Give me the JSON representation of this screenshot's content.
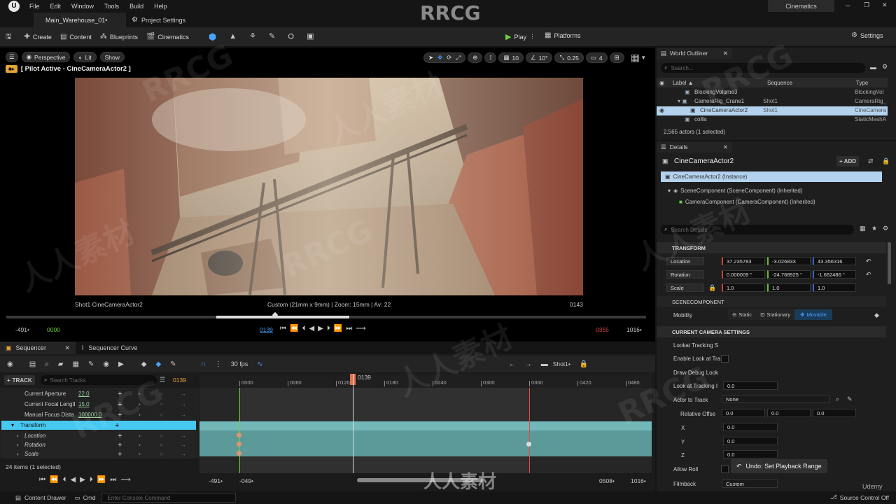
{
  "menu": {
    "items": [
      "File",
      "Edit",
      "Window",
      "Tools",
      "Build",
      "Help"
    ],
    "right_label": "Cinematics"
  },
  "tabs": {
    "level": "Main_Warehouse_01•",
    "settings": "Project Settings"
  },
  "toolbar": {
    "create": "Create",
    "content": "Content",
    "blueprints": "Blueprints",
    "cinematics": "Cinematics",
    "play": "Play",
    "platforms": "Platforms",
    "settings": "Settings"
  },
  "viewport": {
    "perspective": "Perspective",
    "lit": "Lit",
    "show": "Show",
    "pilot": "[ Pilot Active - CineCameraActor2 ]",
    "grid": "10",
    "angle": "10°",
    "scale": "0.25",
    "cams": "4",
    "shot_label": "Shot1  CineCameraActor2",
    "lens": "Custom (21mm x 9mm) | Zoom: 15mm | Av: 22",
    "frame_right": "0143",
    "t_start": "-491•",
    "t_in": "0000",
    "t_cur": "0139",
    "t_out": "0355",
    "t_end": "1016•"
  },
  "sequencer": {
    "tab1": "Sequencer",
    "tab2": "Sequencer Curve",
    "track_btn": "TRACK",
    "search_placeholder": "Search Tracks",
    "frame": "0139",
    "fps": "30 fps",
    "shot": "Shot1•",
    "playhead": "0139",
    "ticks": [
      "0000",
      "0060",
      "0120",
      "0180",
      "0240",
      "0300",
      "0360",
      "0420",
      "0480"
    ],
    "tracks": [
      {
        "label": "Current Aperture",
        "value": "22.0"
      },
      {
        "label": "Current Focal Lengtl",
        "value": "15.0"
      },
      {
        "label": "Manual Focus Dista",
        "value": "100000.0"
      }
    ],
    "transform": "Transform",
    "subtracks": [
      "Location",
      "Rotation",
      "Scale"
    ],
    "count": "24 items (1 selected)",
    "b_start": "-491•",
    "b_in": "-049•",
    "b_out": "0508•",
    "b_end": "1016•"
  },
  "outliner": {
    "title": "World Outliner",
    "search": "Search...",
    "col_label": "Label ▲",
    "col_seq": "Sequence",
    "col_type": "Type",
    "rows": [
      {
        "label": "BlockingVolume3",
        "seq": "",
        "type": "BlockingVol"
      },
      {
        "label": "CameraRig_Crane1",
        "seq": "Shot1",
        "type": "CameraRig_"
      },
      {
        "label": "CineCameraActor2",
        "seq": "Shot1",
        "type": "CineCamera"
      },
      {
        "label": "collis",
        "seq": "",
        "type": "StaticMeshA"
      }
    ],
    "count": "2,565 actors (1 selected)"
  },
  "details": {
    "title": "Details",
    "actor": "CineCameraActor2",
    "add": "ADD",
    "instance": "CineCameraActor2 (Instance)",
    "comp1": "SceneComponent (SceneComponent) (Inherited)",
    "comp2": "CameraComponent (CameraComponent) (Inherited)",
    "search": "Search Details",
    "transform": "TRANSFORM",
    "location": {
      "label": "Location",
      "x": "37.235783",
      "y": "-3.026833",
      "z": "43.356316"
    },
    "rotation": {
      "label": "Rotation",
      "x": "0.000009 °",
      "y": "-24.768925 °",
      "z": "-1.662486 °"
    },
    "scale": {
      "label": "Scale",
      "x": "1.0",
      "y": "1.0",
      "z": "1.0"
    },
    "scenecomp": "SCENECOMPONENT",
    "mobility": "Mobility",
    "static": "Static",
    "stationary": "Stationary",
    "movable": "Movable",
    "camset": "CURRENT CAMERA SETTINGS",
    "lookat": "Lookat Tracking S",
    "enable": "Enable Look at Tra",
    "debug": "Draw Debug Look",
    "interp": "Look at Tracking I",
    "interp_val": "0.0",
    "actor_track": "Actor to Track",
    "actor_val": "None",
    "rel": "Relative Offse",
    "rel_x": "0.0",
    "rel_y": "0.0",
    "rel_z": "0.0",
    "x": "X",
    "y": "Y",
    "z": "Z",
    "xv": "0.0",
    "yv": "0.0",
    "zv": "0.0",
    "roll": "Allow Roll",
    "filmback": "Filmback",
    "filmback_val": "Custom",
    "undo": "Undo: Set Playback Range"
  },
  "status": {
    "drawer": "Content Drawer",
    "cmd": "Cmd",
    "console": "Enter Console Command",
    "source": "Source Control Off"
  },
  "watermark": {
    "main": "RRCG",
    "cn": "人人素材",
    "udemy": "Udemy"
  }
}
